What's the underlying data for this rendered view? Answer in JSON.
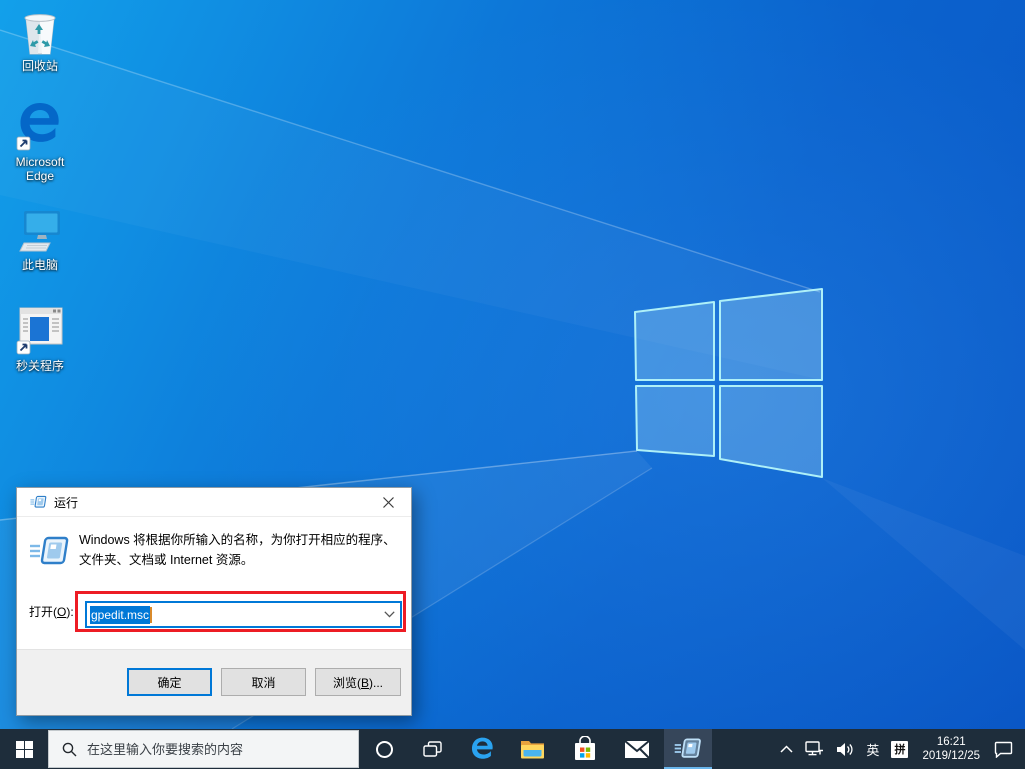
{
  "desktop_icons": [
    {
      "label": "回收站"
    },
    {
      "label": "Microsoft Edge"
    },
    {
      "label": "此电脑"
    },
    {
      "label": "秒关程序"
    }
  ],
  "run_dialog": {
    "title": "运行",
    "description_line1": "Windows 将根据你所输入的名称，为你打开相应的程序、",
    "description_line2": "文件夹、文档或 Internet 资源。",
    "open_label_prefix": "打开(",
    "open_label_key": "O",
    "open_label_suffix": "):",
    "input_value": "gpedit.msc",
    "ok_button": "确定",
    "cancel_button": "取消",
    "browse_prefix": "浏览(",
    "browse_key": "B",
    "browse_suffix": ")..."
  },
  "taskbar": {
    "search_placeholder": "在这里输入你要搜索的内容",
    "tray": {
      "language_indicator": "英",
      "ime_indicator": "拼",
      "time": "16:21",
      "date": "2019/12/25"
    }
  },
  "icons": {
    "start": "windows-logo",
    "search": "magnifier",
    "cortana": "circle-ring",
    "task_view": "overlapping-windows",
    "edge": "edge-e",
    "file_explorer": "folder",
    "store": "shopping-bag",
    "mail": "envelope",
    "run_app": "run-window-speedlines",
    "tray_overflow": "chevron-up",
    "network": "ethernet-monitor",
    "volume": "speaker-waves",
    "action_center": "speech-bubble",
    "dialog_close": "close-x",
    "combo_dropdown": "chevron-down",
    "wallpaper_logo": "windows-flag"
  },
  "colors": {
    "accent_blue": "#0078d7",
    "annotation_red": "#ed1c24",
    "taskbar_bg": "#1e2d3b",
    "selection_bg": "#0078d7",
    "wallpaper_logo_stroke": "#aef0f8"
  }
}
